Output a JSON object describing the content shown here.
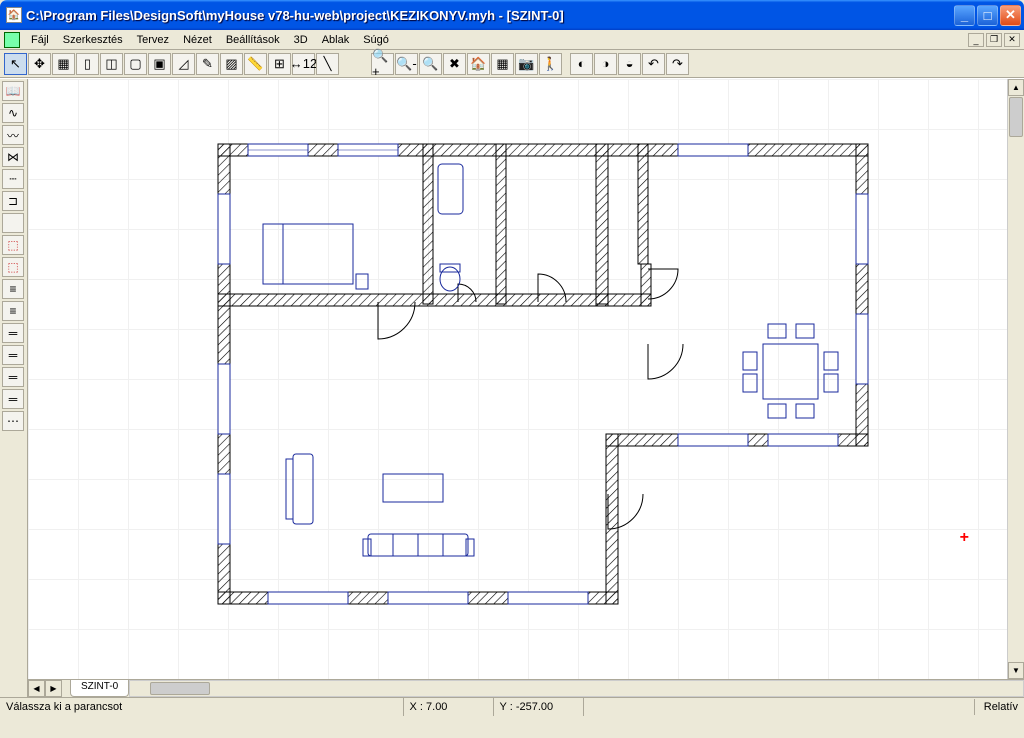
{
  "titlebar": {
    "title": "C:\\Program Files\\DesignSoft\\myHouse v78-hu-web\\project\\KEZIKONYV.myh - [SZINT-0]"
  },
  "menu": {
    "items": [
      "Fájl",
      "Szerkesztés",
      "Tervez",
      "Nézet",
      "Beállítások",
      "3D",
      "Ablak",
      "Súgó"
    ]
  },
  "sheet_tab": "SZINT-0",
  "status": {
    "prompt": "Válassza ki a parancsot",
    "x_label": "X :",
    "x_val": "7.00",
    "y_label": "Y :",
    "y_val": "-257.00",
    "mode": "Relatív"
  },
  "toolbar_main": {
    "arrow": "↖",
    "move": "✥",
    "grid": "▦",
    "column": "▯",
    "window": "◫",
    "door": "▢",
    "door2": "▣",
    "roof": "◿",
    "draw": "✎",
    "paint": "▨",
    "measure": "📏",
    "rail": "⊞",
    "dim": "↔12",
    "line": "╲",
    "zoomin": "🔍+",
    "zoomout": "🔍-",
    "zoomfit": "🔍",
    "tools": "✖",
    "house3d": "🏠",
    "render": "▦",
    "cam": "📷",
    "walk": "🚶",
    "a1": "◐",
    "a2": "◑",
    "a3": "◒",
    "undo": "↶",
    "redo": "↷"
  },
  "toolbar_side": {
    "book": "📖",
    "curve": "∿",
    "zig": "〰",
    "join": "⋈",
    "dash": "┄",
    "bracket": "⊐",
    "s1": " ",
    "red1": "⬚",
    "red2": "⬚",
    "h1": "≡",
    "h2": "≡",
    "h3": "═",
    "h4": "═",
    "h5": "═",
    "h6": "═",
    "dots": "⋯"
  }
}
